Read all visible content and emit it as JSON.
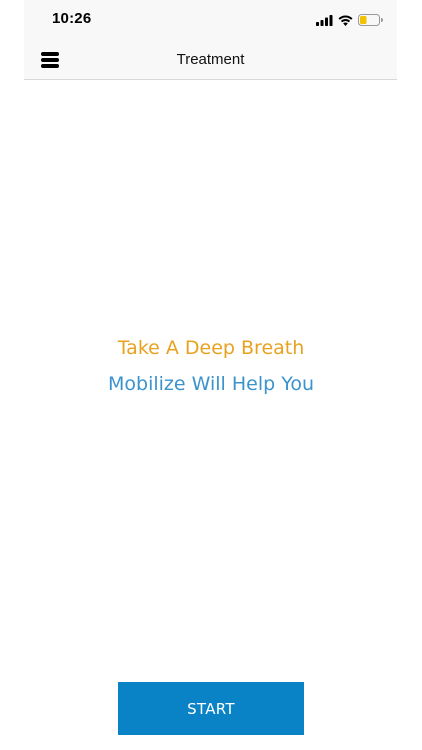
{
  "status_bar": {
    "time": "10:26",
    "icons": [
      "signal-icon",
      "wifi-icon",
      "battery-icon"
    ],
    "battery_color": "#f2c400"
  },
  "nav": {
    "menu_icon": "hamburger-menu-icon",
    "title": "Treatment"
  },
  "main": {
    "primary_message": "Take A Deep Breath",
    "secondary_message": "Mobilize Will Help You"
  },
  "actions": {
    "start_label": "START"
  },
  "colors": {
    "primary_message": "#e8a21f",
    "secondary_message": "#3b93cc",
    "start_button": "#0a83c6"
  }
}
